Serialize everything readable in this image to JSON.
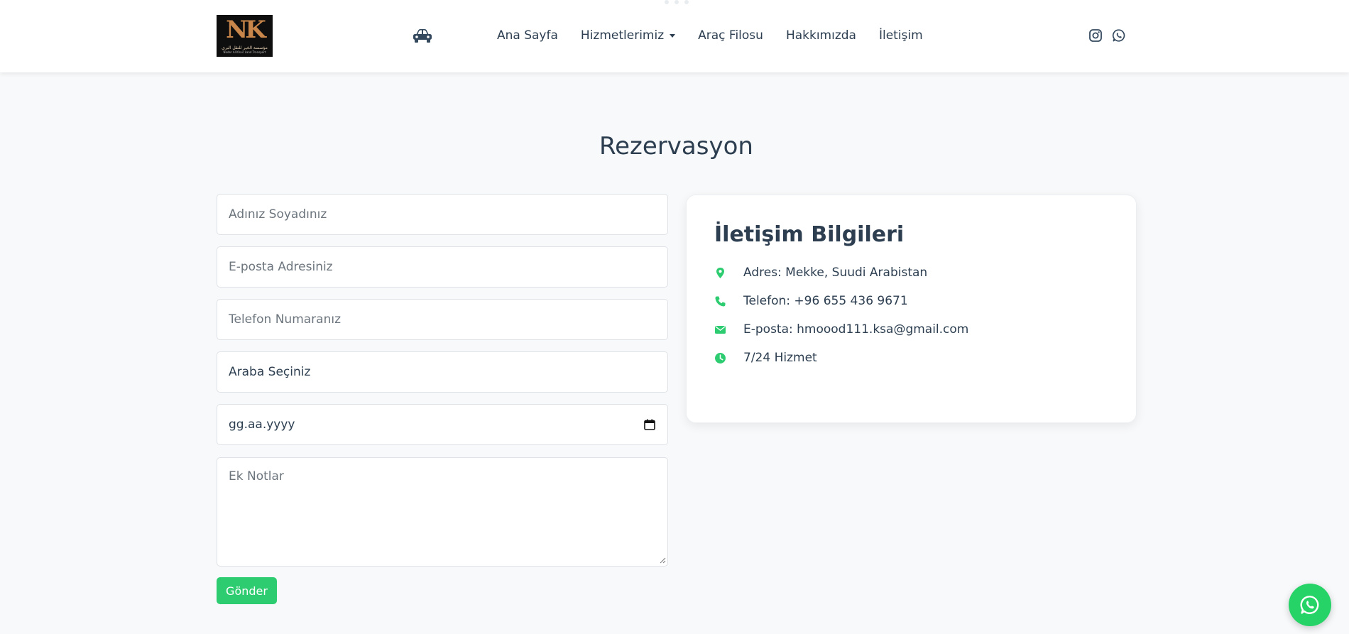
{
  "brand": {
    "logo_monogram": "NK",
    "logo_arabic": "مؤسسة الخير للنقل البري",
    "logo_latin": "Nader Al Khair Land Transport"
  },
  "nav": {
    "items": [
      {
        "label": "Ana Sayfa"
      },
      {
        "label": "Hizmetlerimiz",
        "has_dropdown": true
      },
      {
        "label": "Araç Filosu"
      },
      {
        "label": "Hakkımızda"
      },
      {
        "label": "İletişim"
      }
    ],
    "icons": [
      "car-icon",
      "instagram-icon",
      "whatsapp-icon"
    ]
  },
  "page": {
    "title": "Rezervasyon"
  },
  "form": {
    "name_placeholder": "Adınız Soyadınız",
    "email_placeholder": "E-posta Adresiniz",
    "phone_placeholder": "Telefon Numaranız",
    "car_select_value": "Araba Seçiniz",
    "date_placeholder": "gg.aa.yyyy",
    "notes_placeholder": "Ek Notlar",
    "submit_label": "Gönder"
  },
  "contact": {
    "title": "İletişim Bilgileri",
    "items": [
      {
        "icon": "map-marker-icon",
        "text": "Adres: Mekke, Suudi Arabistan"
      },
      {
        "icon": "phone-icon",
        "text": "Telefon: +96 655 436 9671"
      },
      {
        "icon": "envelope-icon",
        "text": "E-posta: hmoood111.ksa@gmail.com"
      },
      {
        "icon": "clock-icon",
        "text": "7/24 Hizmet"
      }
    ]
  },
  "colors": {
    "accent": "#2ecc71",
    "whatsapp": "#25d366",
    "text": "#2c3e50",
    "background": "#f8f9fa"
  }
}
